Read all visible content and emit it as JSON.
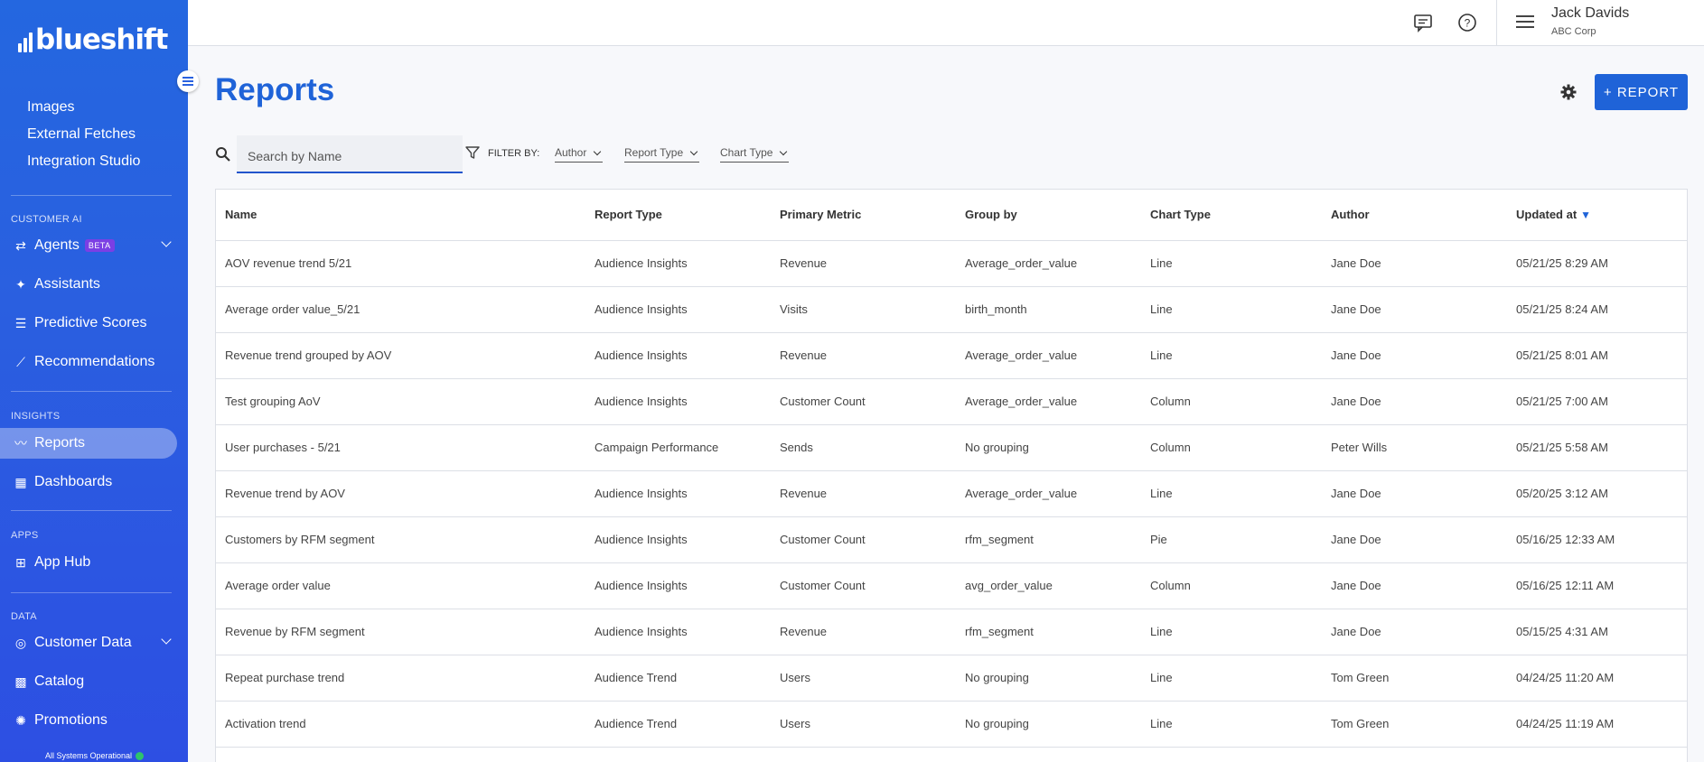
{
  "app": {
    "logo_text": "blueshift",
    "status_text": "All Systems Operational",
    "colors": {
      "brand": "#1f63d8",
      "status_ok": "#2ec36b",
      "beta": "#7b3fe4"
    }
  },
  "sidebar": {
    "subitems": [
      "Images",
      "External Fetches",
      "Integration Studio"
    ],
    "sections": {
      "customer_ai": "CUSTOMER AI",
      "insights": "INSIGHTS",
      "apps": "APPS",
      "data": "DATA"
    },
    "agents": {
      "label": "Agents",
      "badge": "BETA"
    },
    "assistants": "Assistants",
    "predictive_scores": "Predictive Scores",
    "recommendations": "Recommendations",
    "reports": "Reports",
    "dashboards": "Dashboards",
    "app_hub": "App Hub",
    "customer_data": "Customer Data",
    "catalog": "Catalog",
    "promotions": "Promotions"
  },
  "header": {
    "user_name": "Jack Davids",
    "user_org": "ABC Corp"
  },
  "page": {
    "title": "Reports",
    "add_button": "+ REPORT"
  },
  "filters": {
    "search_placeholder": "Search by Name",
    "filter_label": "FILTER BY:",
    "author": "Author",
    "report_type": "Report Type",
    "chart_type": "Chart Type"
  },
  "table": {
    "columns": {
      "name": "Name",
      "report_type": "Report Type",
      "primary_metric": "Primary Metric",
      "group_by": "Group by",
      "chart_type": "Chart Type",
      "author": "Author",
      "updated_at": "Updated at"
    },
    "rows": [
      [
        "AOV revenue trend 5/21",
        "Audience Insights",
        "Revenue",
        "Average_order_value",
        "Line",
        "Jane Doe",
        "05/21/25 8:29 AM"
      ],
      [
        "Average order value_5/21",
        "Audience Insights",
        "Visits",
        "birth_month",
        "Line",
        "Jane Doe",
        "05/21/25 8:24 AM"
      ],
      [
        "Revenue trend grouped by AOV",
        "Audience Insights",
        "Revenue",
        "Average_order_value",
        "Line",
        "Jane Doe",
        "05/21/25 8:01 AM"
      ],
      [
        "Test grouping AoV",
        "Audience Insights",
        "Customer Count",
        "Average_order_value",
        "Column",
        "Jane Doe",
        "05/21/25 7:00 AM"
      ],
      [
        "User purchases - 5/21",
        "Campaign Performance",
        "Sends",
        "No grouping",
        "Column",
        "Peter Wills",
        "05/21/25 5:58 AM"
      ],
      [
        "Revenue trend by AOV",
        "Audience Insights",
        "Revenue",
        "Average_order_value",
        "Line",
        "Jane Doe",
        "05/20/25 3:12 AM"
      ],
      [
        "Customers by RFM segment",
        "Audience Insights",
        "Customer Count",
        "rfm_segment",
        "Pie",
        "Jane Doe",
        "05/16/25 12:33 AM"
      ],
      [
        "Average order value",
        "Audience Insights",
        "Customer Count",
        "avg_order_value",
        "Column",
        "Jane Doe",
        "05/16/25 12:11 AM"
      ],
      [
        "Revenue by RFM segment",
        "Audience Insights",
        "Revenue",
        "rfm_segment",
        "Line",
        "Jane Doe",
        "05/15/25 4:31 AM"
      ],
      [
        "Repeat purchase trend",
        "Audience Trend",
        "Users",
        "No grouping",
        "Line",
        "Tom Green",
        "04/24/25 11:20 AM"
      ],
      [
        "Activation trend",
        "Audience Trend",
        "Users",
        "No grouping",
        "Line",
        "Tom Green",
        "04/24/25 11:19 AM"
      ]
    ]
  }
}
